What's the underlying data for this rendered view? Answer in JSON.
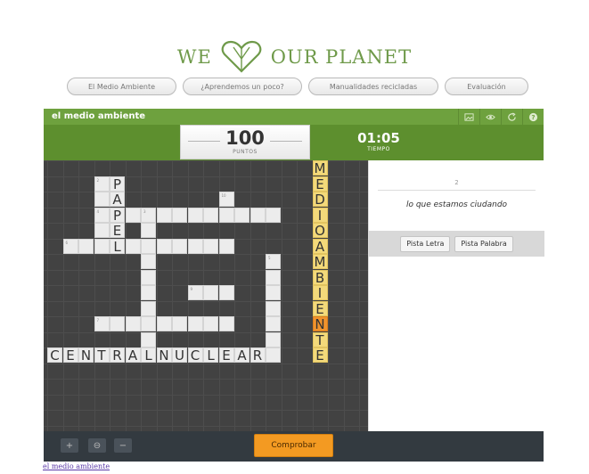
{
  "logo": {
    "word_left": "WE",
    "word_right": "OUR PLANET"
  },
  "nav": [
    {
      "label": "El Medio Ambiente"
    },
    {
      "label": "¿Aprendemos un poco?"
    },
    {
      "label": "Manualidades recicladas"
    },
    {
      "label": "Evaluación"
    }
  ],
  "game": {
    "title": "el medio ambiente",
    "icons": [
      "image-icon",
      "eye-icon",
      "refresh-icon",
      "help-icon"
    ],
    "score_value": "100",
    "score_label": "PUNTOS",
    "time_value": "01:05",
    "time_label": "TIEMPO"
  },
  "board": {
    "letters": [
      {
        "ch": "M",
        "r": 0,
        "c": 17
      },
      {
        "ch": "E",
        "r": 1,
        "c": 17
      },
      {
        "ch": "D",
        "r": 2,
        "c": 17
      },
      {
        "ch": "I",
        "r": 3,
        "c": 17
      },
      {
        "ch": "O",
        "r": 4,
        "c": 17
      },
      {
        "ch": "A",
        "r": 5,
        "c": 17
      },
      {
        "ch": "M",
        "r": 6,
        "c": 17
      },
      {
        "ch": "B",
        "r": 7,
        "c": 17
      },
      {
        "ch": "I",
        "r": 8,
        "c": 17
      },
      {
        "ch": "E",
        "r": 9,
        "c": 17
      },
      {
        "ch": "N",
        "r": 10,
        "c": 17
      },
      {
        "ch": "T",
        "r": 11,
        "c": 17
      },
      {
        "ch": "E",
        "r": 12,
        "c": 17
      },
      {
        "ch": "P",
        "r": 1,
        "c": 4
      },
      {
        "ch": "A",
        "r": 2,
        "c": 4
      },
      {
        "ch": "P",
        "r": 3,
        "c": 4
      },
      {
        "ch": "E",
        "r": 4,
        "c": 4
      },
      {
        "ch": "L",
        "r": 5,
        "c": 4
      },
      {
        "ch": "C",
        "r": 12,
        "c": 0
      },
      {
        "ch": "E",
        "r": 12,
        "c": 1
      },
      {
        "ch": "N",
        "r": 12,
        "c": 2
      },
      {
        "ch": "T",
        "r": 12,
        "c": 3
      },
      {
        "ch": "R",
        "r": 12,
        "c": 4
      },
      {
        "ch": "A",
        "r": 12,
        "c": 5
      },
      {
        "ch": "L",
        "r": 12,
        "c": 6
      },
      {
        "ch": "N",
        "r": 12,
        "c": 7
      },
      {
        "ch": "U",
        "r": 12,
        "c": 8
      },
      {
        "ch": "C",
        "r": 12,
        "c": 9
      },
      {
        "ch": "L",
        "r": 12,
        "c": 10
      },
      {
        "ch": "E",
        "r": 12,
        "c": 11
      },
      {
        "ch": "A",
        "r": 12,
        "c": 12
      },
      {
        "ch": "R",
        "r": 12,
        "c": 13
      }
    ],
    "numbers": [
      {
        "n": "2",
        "r": 1,
        "c": 3
      },
      {
        "n": "4",
        "r": 3,
        "c": 3
      },
      {
        "n": "10",
        "r": 2,
        "c": 11
      },
      {
        "n": "3",
        "r": 3,
        "c": 6
      },
      {
        "n": "6",
        "r": 5,
        "c": 1
      },
      {
        "n": "5",
        "r": 6,
        "c": 14
      },
      {
        "n": "9",
        "r": 8,
        "c": 9
      },
      {
        "n": "7",
        "r": 10,
        "c": 3
      }
    ]
  },
  "panel": {
    "clue_number": "2",
    "clue_text": "lo que estamos ciudando",
    "hint_letter": "Pista Letra",
    "hint_word": "Pista Palabra"
  },
  "footer": {
    "zoom_in": "+",
    "zoom_reset": "⊖",
    "zoom_out": "−",
    "check_label": "Comprobar",
    "link_text": "el medio ambiente"
  },
  "colors": {
    "green": "#6ea13e",
    "dark_green": "#5d8f2e",
    "orange": "#f39a22",
    "yellow": "#f3d97a"
  }
}
